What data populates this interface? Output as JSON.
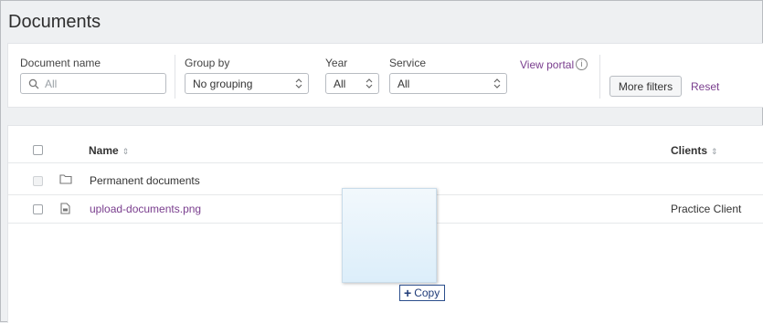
{
  "page_title": "Documents",
  "filters": {
    "document_name": {
      "label": "Document name",
      "placeholder": "All"
    },
    "group_by": {
      "label": "Group by",
      "value": "No grouping"
    },
    "year": {
      "label": "Year",
      "value": "All"
    },
    "service": {
      "label": "Service",
      "value": "All"
    },
    "view_portal": "View portal",
    "info_glyph": "i",
    "more_filters": "More filters",
    "reset": "Reset"
  },
  "table": {
    "columns": {
      "name": "Name",
      "clients": "Clients"
    },
    "sort_glyph": "⇕",
    "rows": [
      {
        "icon": "folder-icon",
        "name": "Permanent documents",
        "client": ""
      },
      {
        "icon": "image-file-icon",
        "name": "upload-documents.png",
        "client": "Practice Client"
      }
    ]
  },
  "drag": {
    "tooltip": "Copy",
    "plus": "+"
  },
  "colors": {
    "link": "#7a3e8e",
    "background": "#eef0f2",
    "tooltip_border": "#2b4e8c"
  }
}
